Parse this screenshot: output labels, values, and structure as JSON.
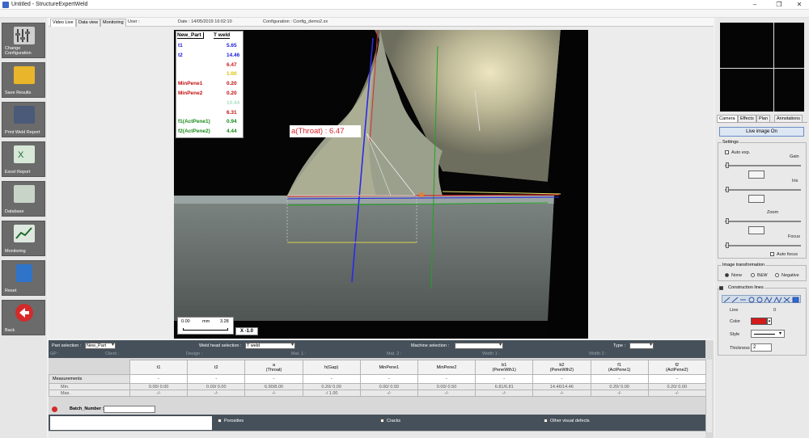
{
  "window": {
    "title": "Untitled - StructureExpertWeld"
  },
  "toolbar": [
    {
      "label": "Change Configuration",
      "icon": "settings-icon"
    },
    {
      "label": "Save Results",
      "icon": "folder-icon"
    },
    {
      "label": "Print Weld Report",
      "icon": "printer-icon"
    },
    {
      "label": "Excel Report",
      "icon": "excel-icon"
    },
    {
      "label": "Database",
      "icon": "database-icon"
    },
    {
      "label": "Monitoring",
      "icon": "monitoring-icon"
    },
    {
      "label": "Reset",
      "icon": "trash-icon"
    },
    {
      "label": "Back",
      "icon": "back-arrow-icon"
    }
  ],
  "tabs": [
    "Video Live",
    "Data view",
    "Monitoring"
  ],
  "header": {
    "user": "User :",
    "date": "Date : 14/05/2019 16:02:10",
    "config": "Configuration : Config_demo2.xx"
  },
  "overlay": {
    "part": "New_Part",
    "weld": "T weld",
    "rows": [
      {
        "name": "t1",
        "value": "5.65",
        "color": "#1a1ad8"
      },
      {
        "name": "t2",
        "value": "14.46",
        "color": "#1a1ad8"
      },
      {
        "name": "",
        "value": "6.47",
        "color": "#d01818"
      },
      {
        "name": "",
        "value": "1.00",
        "color": "#d8c400"
      },
      {
        "name": "MinPene1",
        "value": "0.20",
        "color": "#c01010"
      },
      {
        "name": "MinPene2",
        "value": "0.20",
        "color": "#c01010"
      },
      {
        "name": "",
        "value": "10.44",
        "color": "#aee0c8"
      },
      {
        "name": "",
        "value": "6.31",
        "color": "#c01010"
      },
      {
        "name": "f1(ActPene1)",
        "value": "0.94",
        "color": "#1a8a1a"
      },
      {
        "name": "f2(ActPene2)",
        "value": "4.44",
        "color": "#1a8a1a"
      }
    ],
    "throat_label": "a(Throat) : 6.47",
    "scale": {
      "start": "0.00",
      "unit": "mm",
      "end": "3.28"
    },
    "zoom": "X -1.0"
  },
  "selection": {
    "part_label": "Part selection :",
    "part_value": "New_Part",
    "weld_label": "Weld head selection :",
    "weld_value": "T weld",
    "machine_label": "Machine selection :",
    "machine_value": "",
    "type_label": "Type :",
    "type_value": "",
    "faint": [
      "GP :",
      "Client :",
      "Design :",
      "Mat. 1 :",
      "Mat. 2 :",
      "Width 1 :",
      "Width 2 :"
    ]
  },
  "table": {
    "row_label": "Measurements",
    "min_label": "Min.",
    "max_label": "Max.",
    "columns": [
      {
        "head": "t1",
        "value": "-",
        "min": "0.00/ 0.00",
        "max": "-/-"
      },
      {
        "head": "t2",
        "value": "-",
        "min": "0.00/ 0.00",
        "max": "-/-"
      },
      {
        "head": "a\n(Throat)",
        "value": "-",
        "min": "6.90/8.00",
        "max": "-/-"
      },
      {
        "head": "h(Gap)",
        "value": "-",
        "min": "0.20/ 0.00",
        "max": "-/ 1.00"
      },
      {
        "head": "MinPene1",
        "value": "-",
        "min": "0.00/ 0.50",
        "max": "-/-"
      },
      {
        "head": "MinPene2",
        "value": "-",
        "min": "0.00/ 0.50",
        "max": "-/-"
      },
      {
        "head": "b1\n(PeneWth1)",
        "value": "-",
        "min": "6.81/6.81",
        "max": "-/-"
      },
      {
        "head": "b2\n(PeneWth2)",
        "value": "-",
        "min": "14.46/14.46",
        "max": "-/-"
      },
      {
        "head": "f1\n(ActPene1)",
        "value": "-",
        "min": "0.20/ 0.00",
        "max": "-/-"
      },
      {
        "head": "f2\n(ActPene2)",
        "value": "-",
        "min": "0.20/ 0.00",
        "max": "-/-"
      }
    ]
  },
  "batch": {
    "label": "Batch_Number :",
    "value": ""
  },
  "defects": [
    "Porosities",
    "Cracks",
    "Other visual defects"
  ],
  "right": {
    "tabs": [
      "Camera",
      "Effects",
      "Plan",
      "Annotations"
    ],
    "live_button": "Live image On",
    "settings_title": "Settings",
    "auto_exp": "Auto exp.",
    "gain": "Gain",
    "iris": "Iris",
    "zoom": "Zoom",
    "focus": "Focus",
    "auto_focus": "Auto focus",
    "transform_title": "Image transformation",
    "transform_options": [
      "None",
      "B&W",
      "Negative"
    ],
    "construction_title": "Construction lines",
    "line_label": "Line",
    "line_value": "0",
    "color_label": "Color",
    "style_label": "Style",
    "thickness_label": "Thickness",
    "thickness_value": "2",
    "accent": "#d41a1a"
  }
}
